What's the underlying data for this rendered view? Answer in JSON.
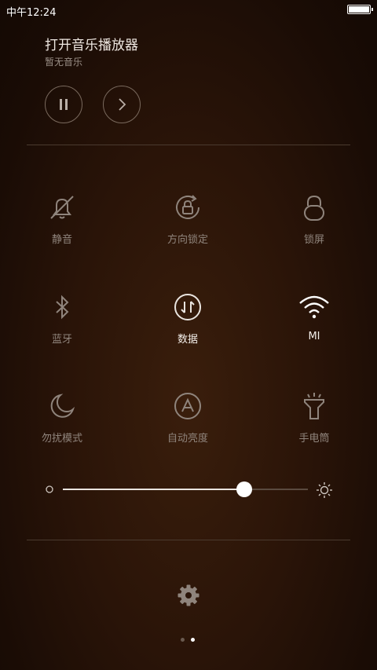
{
  "status_bar": {
    "time": "中午12:24",
    "battery_level": 1.0
  },
  "music": {
    "title": "打开音乐播放器",
    "subtitle": "暂无音乐"
  },
  "toggles": [
    {
      "label": "静音",
      "icon": "bell-off-icon",
      "active": false
    },
    {
      "label": "方向锁定",
      "icon": "rotation-lock-icon",
      "active": false
    },
    {
      "label": "锁屏",
      "icon": "lock-icon",
      "active": false
    },
    {
      "label": "蓝牙",
      "icon": "bluetooth-icon",
      "active": false
    },
    {
      "label": "数据",
      "icon": "mobile-data-icon",
      "active": true
    },
    {
      "label": "MI",
      "icon": "wifi-icon",
      "active": true
    },
    {
      "label": "勿扰模式",
      "icon": "moon-icon",
      "active": false
    },
    {
      "label": "自动亮度",
      "icon": "auto-brightness-icon",
      "active": false
    },
    {
      "label": "手电筒",
      "icon": "flashlight-icon",
      "active": false
    }
  ],
  "brightness": {
    "level": 0.74
  },
  "page_indicator": {
    "pages": 2,
    "current": 2
  },
  "colors": {
    "active": "#f3eee9",
    "inactive": "#8f847c"
  }
}
